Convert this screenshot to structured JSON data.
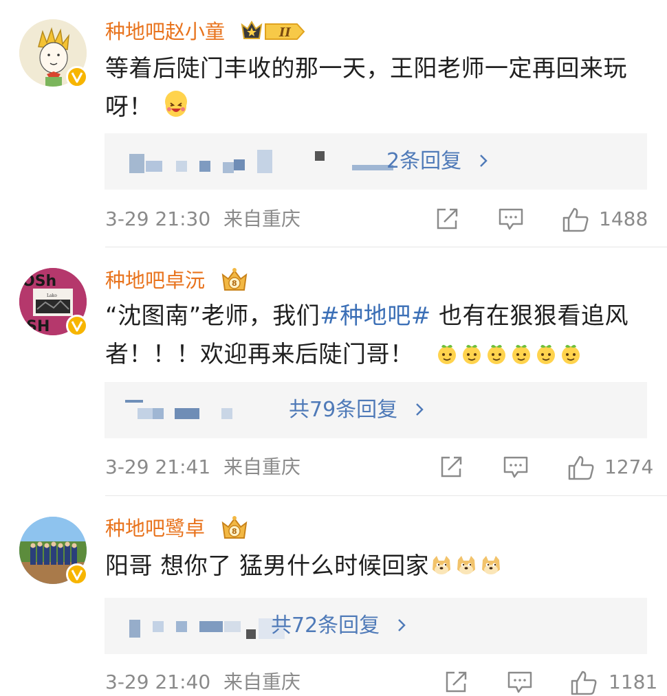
{
  "comments": [
    {
      "username": "种地吧赵小童",
      "content": "等着后陡门丰收的那一天，王阳老师一定再回来玩呀！",
      "reply_link": "2条回复",
      "time": "3-29 21:30",
      "location": "来自重庆",
      "likes": "1488"
    },
    {
      "username": "种地吧卓沅",
      "content_pre": "“沈图南”老师，我们",
      "content_topic": "#种地吧#",
      "content_post": " 也有在狠狠看追风者！！！欢迎再来后陡门哥！",
      "reply_link": "共79条回复",
      "time": "3-29 21:41",
      "location": "来自重庆",
      "likes": "1274"
    },
    {
      "username": "种地吧鹭卓",
      "content": "阳哥 想你了 猛男什么时候回家",
      "reply_link": "共72条回复",
      "time": "3-29 21:40",
      "location": "来自重庆",
      "likes": "1181"
    }
  ],
  "icons": {
    "repost": "share-icon",
    "comment": "comment-icon",
    "like": "like-icon",
    "chevron": "chevron-right-icon",
    "verified": "verified-badge-icon"
  },
  "colors": {
    "username": "#e8731d",
    "link": "#4f7ab8",
    "meta": "#8a8a8a",
    "reply_bg": "#f5f5f5"
  }
}
